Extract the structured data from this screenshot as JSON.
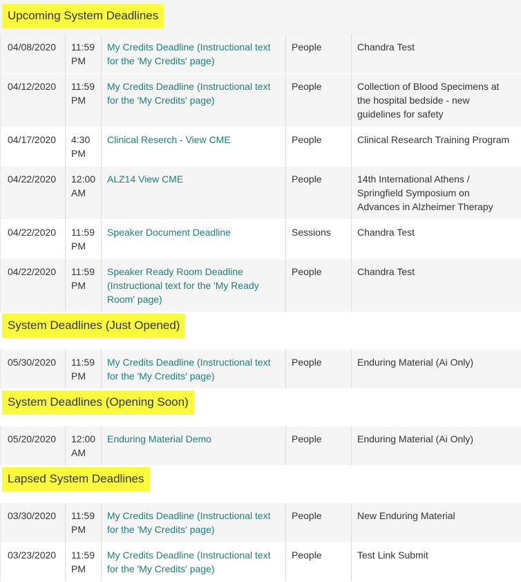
{
  "sections": [
    {
      "title": "Upcoming System Deadlines",
      "rows": [
        {
          "date": "04/08/2020",
          "time": "11:59 PM",
          "description": "My Credits Deadline (Instructional text for the 'My Credits' page)",
          "type": "People",
          "name": "Chandra Test"
        },
        {
          "date": "04/12/2020",
          "time": "11:59 PM",
          "description": "My Credits Deadline (Instructional text for the 'My Credits' page)",
          "type": "People",
          "name": "Collection of Blood Specimens at the hospital bedside - new guidelines for safety"
        },
        {
          "date": "04/17/2020",
          "time": "4:30 PM",
          "description": "Clinical Reserch - View CME",
          "type": "People",
          "name": "Clinical Research Training Program"
        },
        {
          "date": "04/22/2020",
          "time": "12:00 AM",
          "description": "ALZ14 View CME",
          "type": "People",
          "name": "14th International Athens / Springfield Symposium on Advances in Alzheimer Therapy"
        },
        {
          "date": "04/22/2020",
          "time": "11:59 PM",
          "description": "Speaker Document Deadline",
          "type": "Sessions",
          "name": "Chandra Test"
        },
        {
          "date": "04/22/2020",
          "time": "11:59 PM",
          "description": "Speaker Ready Room Deadline (Instructional text for the 'My Ready Room' page)",
          "type": "People",
          "name": "Chandra Test"
        }
      ]
    },
    {
      "title": "System Deadlines (Just Opened)",
      "rows": [
        {
          "date": "05/30/2020",
          "time": "11:59 PM",
          "description": "My Credits Deadline (Instructional text for the 'My Credits' page)",
          "type": "People",
          "name": "Enduring Material (Ai Only)"
        }
      ]
    },
    {
      "title": "System Deadlines (Opening Soon)",
      "rows": [
        {
          "date": "05/20/2020",
          "time": "12:00 AM",
          "description": "Enduring Material Demo",
          "type": "People",
          "name": "Enduring Material (Ai Only)"
        }
      ]
    },
    {
      "title": "Lapsed System Deadlines",
      "rows": [
        {
          "date": "03/30/2020",
          "time": "11:59 PM",
          "description": "My Credits Deadline (Instructional text for the 'My Credits' page)",
          "type": "People",
          "name": "New Enduring Material"
        },
        {
          "date": "03/23/2020",
          "time": "11:59 PM",
          "description": "My Credits Deadline (Instructional text for the 'My Credits' page)",
          "type": "People",
          "name": "Test Link Submit"
        }
      ]
    }
  ],
  "colors": {
    "highlight": "#fafa3c",
    "link": "#1a7f7a",
    "row_shade": "#f5f5f5"
  }
}
